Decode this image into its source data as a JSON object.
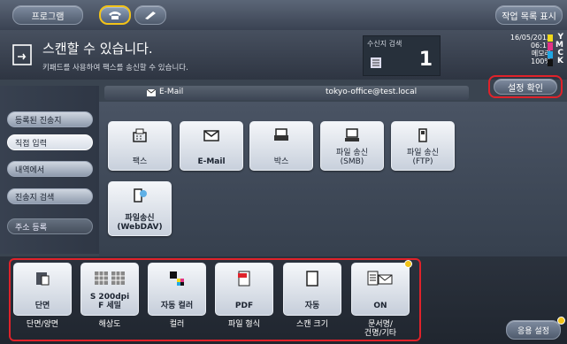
{
  "topbar": {
    "program_label": "프로그램",
    "job_list_label": "작업 목록 표시"
  },
  "header": {
    "title": "스캔할 수 있습니다.",
    "subtitle": "키패드를 사용하여 팩스를 송신할 수 있습니다.",
    "dest_search_label": "수신지 검색",
    "dest_count": "1"
  },
  "status": {
    "date": "16/05/2013",
    "time": "06:17",
    "memory_label": "메모리",
    "memory_value": "100%",
    "toner": [
      "Y",
      "M",
      "C",
      "K"
    ]
  },
  "email_bar": {
    "label": "E-Mail",
    "address": "tokyo-office@test.local"
  },
  "settings_check_label": "설정 확인",
  "nav": [
    "등록된 진송지",
    "직접 입력",
    "내역에서",
    "진송지 검색",
    "주소 등록"
  ],
  "dest_tiles": [
    {
      "label": "팩스",
      "icon": "fax-icon"
    },
    {
      "label": "E-Mail",
      "icon": "envelope-icon"
    },
    {
      "label": "박스",
      "icon": "box-icon"
    },
    {
      "label": "파일 송신\n(SMB)",
      "icon": "pc-icon"
    },
    {
      "label": "파일 송신\n(FTP)",
      "icon": "ftp-icon"
    },
    {
      "label": "파일송신\n(WebDAV)",
      "icon": "webdav-icon"
    }
  ],
  "function_buttons": [
    {
      "value": "단면",
      "label": "단면/양면"
    },
    {
      "value": "S 200dpi\nF 세밀",
      "label": "해상도"
    },
    {
      "value": "자동 컬러",
      "label": "컬러"
    },
    {
      "value": "PDF",
      "label": "파일 형식"
    },
    {
      "value": "자동",
      "label": "스캔 크기"
    },
    {
      "value": "ON",
      "label": "문서명/\n건명/기타"
    }
  ],
  "apply_settings_label": "응용 설정",
  "colors": {
    "accent_red": "#e0222a",
    "highlight_yellow": "#f2c318"
  }
}
